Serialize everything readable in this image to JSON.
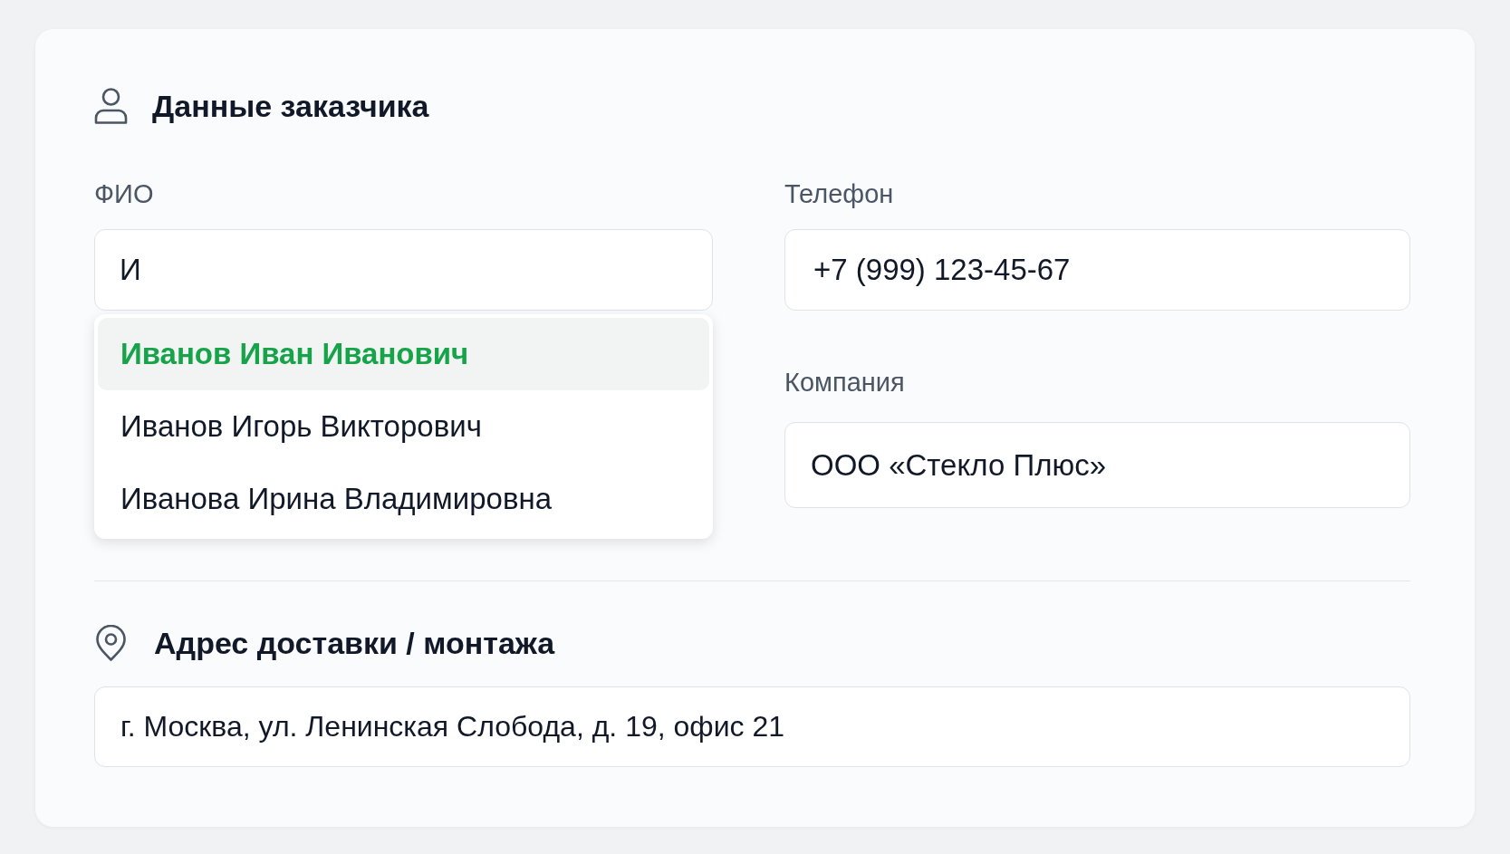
{
  "customer_section": {
    "title": "Данные заказчика",
    "name_field": {
      "label": "ФИО",
      "value": "И",
      "suggestions": [
        {
          "text": "Иванов Иван Иванович",
          "selected": true
        },
        {
          "text": "Иванов Игорь Викторович",
          "selected": false
        },
        {
          "text": "Иванова Ирина Владимировна",
          "selected": false
        }
      ]
    },
    "phone_field": {
      "label": "Телефон",
      "value": "+7 (999) 123-45-67"
    },
    "company_field": {
      "label": "Компания",
      "value": "ООО «Стекло Плюс»"
    }
  },
  "address_section": {
    "title": "Адрес доставки / монтажа",
    "address_field": {
      "value": "г. Москва, ул. Ленинская Слобода, д. 19, офис 21"
    }
  }
}
